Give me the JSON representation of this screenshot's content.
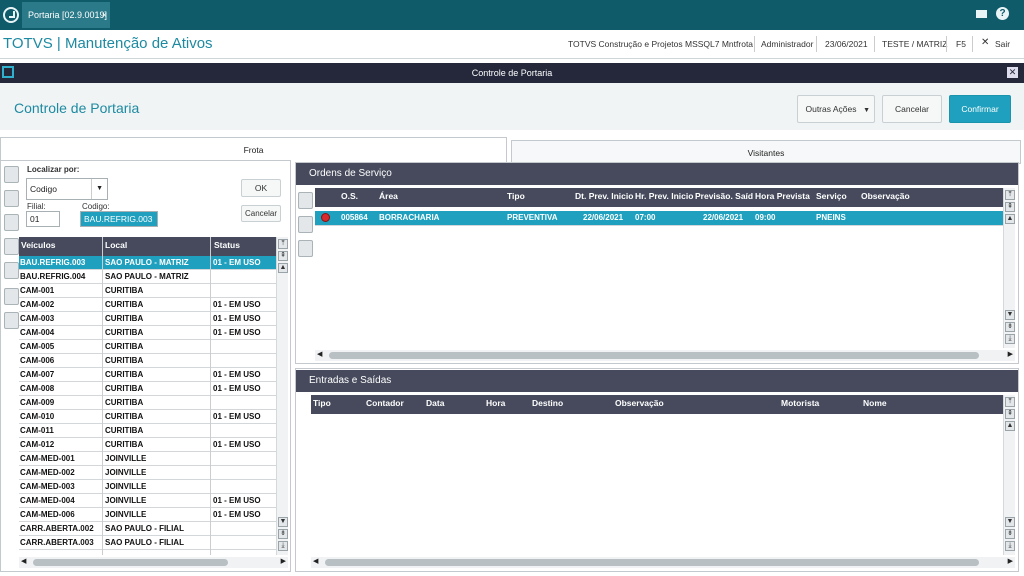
{
  "topbar": {
    "tab_label": "Portaria [02.9.0019]",
    "tab_close": "×"
  },
  "appbar": {
    "title": "TOTVS | Manutenção de Ativos",
    "company": "TOTVS Construção e Projetos MSSQL7 Mntfrota",
    "user": "Administrador",
    "date": "23/06/2021",
    "branch": "TESTE / MATRIZ",
    "shortcut": "F5",
    "exit": "Sair"
  },
  "modal": {
    "title": "Controle de Portaria",
    "heading": "Controle de Portaria",
    "outras_acoes": "Outras Ações",
    "cancelar": "Cancelar",
    "confirmar": "Confirmar"
  },
  "folders": {
    "frota": "Frota",
    "visitantes": "Visitantes"
  },
  "search": {
    "localizar_label": "Localizar por:",
    "localizar_value": "Codigo",
    "filial_label": "Filial:",
    "filial_value": "01",
    "codigo_label": "Codigo:",
    "codigo_value": "BAU.REFRIG.003",
    "ok": "OK",
    "cancelar": "Cancelar"
  },
  "vehicles": {
    "headers": [
      "Veículos",
      "Local",
      "Status"
    ],
    "rows": [
      [
        "BAU.REFRIG.003",
        "SAO PAULO - MATRIZ",
        "01 - EM USO"
      ],
      [
        "BAU.REFRIG.004",
        "SAO PAULO - MATRIZ",
        ""
      ],
      [
        "CAM-001",
        "CURITIBA",
        ""
      ],
      [
        "CAM-002",
        "CURITIBA",
        "01 - EM USO"
      ],
      [
        "CAM-003",
        "CURITIBA",
        "01 - EM USO"
      ],
      [
        "CAM-004",
        "CURITIBA",
        "01 - EM USO"
      ],
      [
        "CAM-005",
        "CURITIBA",
        ""
      ],
      [
        "CAM-006",
        "CURITIBA",
        ""
      ],
      [
        "CAM-007",
        "CURITIBA",
        "01 - EM USO"
      ],
      [
        "CAM-008",
        "CURITIBA",
        "01 - EM USO"
      ],
      [
        "CAM-009",
        "CURITIBA",
        ""
      ],
      [
        "CAM-010",
        "CURITIBA",
        "01 - EM USO"
      ],
      [
        "CAM-011",
        "CURITIBA",
        ""
      ],
      [
        "CAM-012",
        "CURITIBA",
        "01 - EM USO"
      ],
      [
        "CAM-MED-001",
        "JOINVILLE",
        ""
      ],
      [
        "CAM-MED-002",
        "JOINVILLE",
        ""
      ],
      [
        "CAM-MED-003",
        "JOINVILLE",
        ""
      ],
      [
        "CAM-MED-004",
        "JOINVILLE",
        "01 - EM USO"
      ],
      [
        "CAM-MED-006",
        "JOINVILLE",
        "01 - EM USO"
      ],
      [
        "CARR.ABERTA.002",
        "SAO PAULO - FILIAL",
        ""
      ],
      [
        "CARR.ABERTA.003",
        "SAO PAULO - FILIAL",
        ""
      ]
    ]
  },
  "ordens": {
    "title": "Ordens de Serviço",
    "headers": [
      "O.S.",
      "Área",
      "Tipo",
      "Dt. Prev. Inicio",
      "Hr. Prev. Inicio",
      "Previsão. Saíd",
      "Hora Prevista",
      "Serviço",
      "Observação"
    ],
    "rows": [
      [
        "005864",
        "BORRACHARIA",
        "PREVENTIVA",
        "22/06/2021",
        "07:00",
        "22/06/2021",
        "09:00",
        "PNEINS",
        ""
      ]
    ]
  },
  "entradas": {
    "title": "Entradas e Saídas",
    "headers": [
      "Tipo",
      "Contador",
      "Data",
      "Hora",
      "Destino",
      "Observação",
      "Motorista",
      "Nome"
    ]
  },
  "colors": {
    "topbar": "#0f5b6a",
    "accent": "#1fa0be",
    "grid_header": "#464a5c",
    "modal_title": "#24283a"
  }
}
